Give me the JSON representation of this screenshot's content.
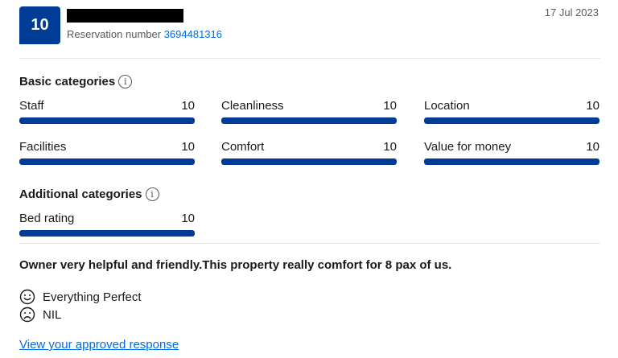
{
  "header": {
    "score": "10",
    "reservation_label": "Reservation number",
    "reservation_number": "3694481316",
    "date": "17 Jul 2023"
  },
  "basic": {
    "title": "Basic categories",
    "items": [
      {
        "label": "Staff",
        "score": "10",
        "value": 10
      },
      {
        "label": "Cleanliness",
        "score": "10",
        "value": 10
      },
      {
        "label": "Location",
        "score": "10",
        "value": 10
      },
      {
        "label": "Facilities",
        "score": "10",
        "value": 10
      },
      {
        "label": "Comfort",
        "score": "10",
        "value": 10
      },
      {
        "label": "Value for money",
        "score": "10",
        "value": 10
      }
    ]
  },
  "additional": {
    "title": "Additional categories",
    "items": [
      {
        "label": "Bed rating",
        "score": "10",
        "value": 10
      }
    ]
  },
  "review": {
    "title": "Owner very helpful and friendly.This property really comfort for 8 pax of us.",
    "positive": "Everything Perfect",
    "negative": "NIL"
  },
  "response_link": "View your approved response",
  "colors": {
    "brand": "#003b95",
    "link": "#006ce4",
    "divider": "#e7e7e7"
  },
  "icons": {
    "info": "info-icon",
    "positive": "smile-icon",
    "negative": "frown-icon"
  }
}
